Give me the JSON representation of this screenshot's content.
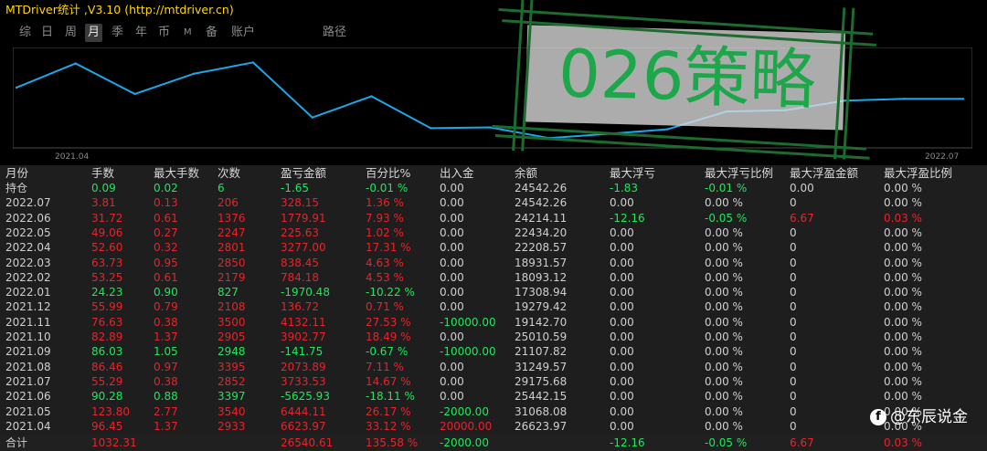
{
  "window": {
    "title": "MTDriver统计 ,V3.10 (http://mtdriver.cn)"
  },
  "tabs": [
    {
      "label": "综",
      "active": false
    },
    {
      "label": "日",
      "active": false
    },
    {
      "label": "周",
      "active": false
    },
    {
      "label": "月",
      "active": true
    },
    {
      "label": "季",
      "active": false
    },
    {
      "label": "年",
      "active": false
    },
    {
      "label": "币",
      "active": false
    },
    {
      "label": "M",
      "active": false
    },
    {
      "label": "备",
      "active": false
    },
    {
      "label": "账户",
      "active": false
    },
    {
      "label": "路径",
      "active": false
    }
  ],
  "chart_data": {
    "type": "line",
    "x_start_label": "2021.04",
    "x_end_label": "2022.07",
    "x": [
      "2021.04",
      "2021.05",
      "2021.06",
      "2021.07",
      "2021.08",
      "2021.09",
      "2021.10",
      "2021.11",
      "2021.12",
      "2022.01",
      "2022.02",
      "2022.03",
      "2022.04",
      "2022.05",
      "2022.06",
      "2022.07",
      "持仓"
    ],
    "values": [
      26623.97,
      31068.08,
      25442.15,
      29175.68,
      31249.57,
      21107.82,
      25010.59,
      19142.7,
      19279.42,
      17308.94,
      18093.12,
      18931.57,
      22208.57,
      22434.2,
      24214.11,
      24542.26,
      24542.26
    ],
    "line_color": "#1ba8e8"
  },
  "table": {
    "columns": [
      "月份",
      "手数",
      "最大手数",
      "次数",
      "盈亏金额",
      "百分比%",
      "出入金",
      "余额",
      "最大浮亏",
      "最大浮亏比例",
      "最大浮盈金额",
      "最大浮盈比例"
    ],
    "rows": [
      [
        "持仓",
        "0.09",
        "0.02",
        "6",
        "-1.65",
        "-0.01 %",
        "0.00",
        "24542.26",
        "-1.83",
        "-0.01 %",
        "0.00",
        "0.00 %"
      ],
      [
        "2022.07",
        "3.81",
        "0.13",
        "206",
        "328.15",
        "1.36 %",
        "0.00",
        "24542.26",
        "0.00",
        "0.00 %",
        "0",
        "0.00 %"
      ],
      [
        "2022.06",
        "31.72",
        "0.61",
        "1376",
        "1779.91",
        "7.93 %",
        "0.00",
        "24214.11",
        "-12.16",
        "-0.05 %",
        "6.67",
        "0.03 %"
      ],
      [
        "2022.05",
        "49.06",
        "0.27",
        "2247",
        "225.63",
        "1.02 %",
        "0.00",
        "22434.20",
        "0.00",
        "0.00 %",
        "0",
        "0.00 %"
      ],
      [
        "2022.04",
        "52.60",
        "0.32",
        "2801",
        "3277.00",
        "17.31 %",
        "0.00",
        "22208.57",
        "0.00",
        "0.00 %",
        "0",
        "0.00 %"
      ],
      [
        "2022.03",
        "63.73",
        "0.95",
        "2850",
        "838.45",
        "4.63 %",
        "0.00",
        "18931.57",
        "0.00",
        "0.00 %",
        "0",
        "0.00 %"
      ],
      [
        "2022.02",
        "53.25",
        "0.61",
        "2179",
        "784.18",
        "4.53 %",
        "0.00",
        "18093.12",
        "0.00",
        "0.00 %",
        "0",
        "0.00 %"
      ],
      [
        "2022.01",
        "24.23",
        "0.90",
        "827",
        "-1970.48",
        "-10.22 %",
        "0.00",
        "17308.94",
        "0.00",
        "0.00 %",
        "0",
        "0.00 %"
      ],
      [
        "2021.12",
        "55.99",
        "0.79",
        "2108",
        "136.72",
        "0.71 %",
        "0.00",
        "19279.42",
        "0.00",
        "0.00 %",
        "0",
        "0.00 %"
      ],
      [
        "2021.11",
        "76.63",
        "0.38",
        "3500",
        "4132.11",
        "27.53 %",
        "-10000.00",
        "19142.70",
        "0.00",
        "0.00 %",
        "0",
        "0.00 %"
      ],
      [
        "2021.10",
        "82.89",
        "1.37",
        "2905",
        "3902.77",
        "18.49 %",
        "0.00",
        "25010.59",
        "0.00",
        "0.00 %",
        "0",
        "0.00 %"
      ],
      [
        "2021.09",
        "86.03",
        "1.05",
        "2948",
        "-141.75",
        "-0.67 %",
        "-10000.00",
        "21107.82",
        "0.00",
        "0.00 %",
        "0",
        "0.00 %"
      ],
      [
        "2021.08",
        "86.46",
        "0.97",
        "3395",
        "2073.89",
        "7.11 %",
        "0.00",
        "31249.57",
        "0.00",
        "0.00 %",
        "0",
        "0.00 %"
      ],
      [
        "2021.07",
        "55.29",
        "0.38",
        "2852",
        "3733.53",
        "14.67 %",
        "0.00",
        "29175.68",
        "0.00",
        "0.00 %",
        "0",
        "0.00 %"
      ],
      [
        "2021.06",
        "90.28",
        "0.88",
        "3397",
        "-5625.93",
        "-18.11 %",
        "0.00",
        "25442.15",
        "0.00",
        "0.00 %",
        "0",
        "0.00 %"
      ],
      [
        "2021.05",
        "123.80",
        "2.77",
        "3540",
        "6444.11",
        "26.17 %",
        "-2000.00",
        "31068.08",
        "0.00",
        "0.00 %",
        "0",
        "0.00 %"
      ],
      [
        "2021.04",
        "96.45",
        "1.37",
        "2933",
        "6623.97",
        "33.12 %",
        "20000.00",
        "26623.97",
        "0.00",
        "0.00 %",
        "0",
        "0.00 %"
      ]
    ],
    "row_colors": [
      [
        "white",
        "green",
        "green",
        "green",
        "green",
        "green",
        "white",
        "white",
        "green",
        "green",
        "white",
        "white"
      ],
      [
        "white",
        "red",
        "red",
        "red",
        "red",
        "red",
        "white",
        "white",
        "white",
        "white",
        "white",
        "white"
      ],
      [
        "white",
        "red",
        "red",
        "red",
        "red",
        "red",
        "white",
        "white",
        "green",
        "green",
        "red",
        "red"
      ],
      [
        "white",
        "red",
        "red",
        "red",
        "red",
        "red",
        "white",
        "white",
        "white",
        "white",
        "white",
        "white"
      ],
      [
        "white",
        "red",
        "red",
        "red",
        "red",
        "red",
        "white",
        "white",
        "white",
        "white",
        "white",
        "white"
      ],
      [
        "white",
        "red",
        "red",
        "red",
        "red",
        "red",
        "white",
        "white",
        "white",
        "white",
        "white",
        "white"
      ],
      [
        "white",
        "red",
        "red",
        "red",
        "red",
        "red",
        "white",
        "white",
        "white",
        "white",
        "white",
        "white"
      ],
      [
        "white",
        "green",
        "green",
        "green",
        "green",
        "green",
        "white",
        "white",
        "white",
        "white",
        "white",
        "white"
      ],
      [
        "white",
        "red",
        "red",
        "red",
        "red",
        "red",
        "white",
        "white",
        "white",
        "white",
        "white",
        "white"
      ],
      [
        "white",
        "red",
        "red",
        "red",
        "red",
        "red",
        "green",
        "white",
        "white",
        "white",
        "white",
        "white"
      ],
      [
        "white",
        "red",
        "red",
        "red",
        "red",
        "red",
        "white",
        "white",
        "white",
        "white",
        "white",
        "white"
      ],
      [
        "white",
        "green",
        "green",
        "green",
        "green",
        "green",
        "green",
        "white",
        "white",
        "white",
        "white",
        "white"
      ],
      [
        "white",
        "red",
        "red",
        "red",
        "red",
        "red",
        "white",
        "white",
        "white",
        "white",
        "white",
        "white"
      ],
      [
        "white",
        "red",
        "red",
        "red",
        "red",
        "red",
        "white",
        "white",
        "white",
        "white",
        "white",
        "white"
      ],
      [
        "white",
        "green",
        "green",
        "green",
        "green",
        "green",
        "white",
        "white",
        "white",
        "white",
        "white",
        "white"
      ],
      [
        "white",
        "red",
        "red",
        "red",
        "red",
        "red",
        "green",
        "white",
        "white",
        "white",
        "white",
        "white"
      ],
      [
        "white",
        "red",
        "red",
        "red",
        "red",
        "red",
        "red",
        "white",
        "white",
        "white",
        "white",
        "white"
      ]
    ],
    "total": {
      "cells": [
        "合计",
        "1032.31",
        "",
        "",
        "26540.61",
        "135.58 %",
        "-2000.00",
        "",
        "-12.16",
        "-0.05 %",
        "6.67",
        "0.03 %"
      ],
      "colors": [
        "white",
        "red",
        "white",
        "white",
        "red",
        "red",
        "green",
        "white",
        "green",
        "green",
        "red",
        "red"
      ]
    }
  },
  "stamp": {
    "text": "026策略"
  },
  "watermark": {
    "icon": "f",
    "text": "@东辰说金"
  },
  "colors": {
    "red": "#e8232a",
    "green": "#1ee85a",
    "title": "#ffd700",
    "line": "#1ba8e8"
  }
}
